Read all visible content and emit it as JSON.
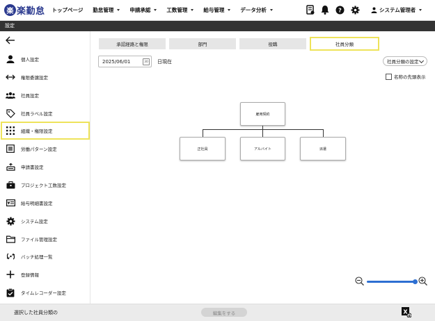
{
  "app": {
    "logo_mark": "楽",
    "logo_text": "楽勤怠"
  },
  "nav": {
    "items": [
      {
        "label": "トップページ",
        "dropdown": false
      },
      {
        "label": "勤怠管理",
        "dropdown": true
      },
      {
        "label": "申請承認",
        "dropdown": true
      },
      {
        "label": "工数管理",
        "dropdown": true
      },
      {
        "label": "給与管理",
        "dropdown": true
      },
      {
        "label": "データ分析",
        "dropdown": true
      }
    ],
    "icons": [
      "report-icon",
      "bell-icon",
      "help-icon",
      "gear-icon"
    ],
    "user_label": "システム管理者"
  },
  "page_bar": {
    "title": "設定"
  },
  "sidebar": {
    "back_icon": "arrow-left-icon",
    "items": [
      {
        "label": "個人設定",
        "icon": "person-icon"
      },
      {
        "label": "権限委譲設定",
        "icon": "swap-arrows-icon"
      },
      {
        "label": "社員設定",
        "icon": "group-icon"
      },
      {
        "label": "社員ラベル設定",
        "icon": "tag-icon"
      },
      {
        "label": "組織・権限設定",
        "icon": "grid-dots-icon",
        "selected": true
      },
      {
        "label": "労働パターン設定",
        "icon": "list-icon"
      },
      {
        "label": "申請書設定",
        "icon": "inbox-icon"
      },
      {
        "label": "プロジェクト工数設定",
        "icon": "briefcase-icon"
      },
      {
        "label": "給与明細書設定",
        "icon": "payslip-icon"
      },
      {
        "label": "システム設定",
        "icon": "gear-icon"
      },
      {
        "label": "ファイル管理設定",
        "icon": "folder-icon"
      },
      {
        "label": "バッチ処理一覧",
        "icon": "sync-icon"
      },
      {
        "label": "登録情報",
        "icon": "plus-icon"
      },
      {
        "label": "タイムレコーダー設定",
        "icon": "clipboard-check-icon"
      }
    ]
  },
  "tabs": [
    {
      "label": "承認経路と権限",
      "active": false
    },
    {
      "label": "部門",
      "active": false
    },
    {
      "label": "役職",
      "active": false
    },
    {
      "label": "社員分類",
      "active": true
    }
  ],
  "date_filter": {
    "value": "2025/06/01",
    "calendar_text": "30",
    "suffix": "日現在"
  },
  "settings_dropdown": {
    "label": "社員分類の設定"
  },
  "checkbox": {
    "label": "名称の先頭表示",
    "checked": false
  },
  "org_chart": {
    "root": "雇用契約",
    "children": [
      "正社員",
      "アルバイト",
      "派遣"
    ]
  },
  "zoom": {
    "level": 1.0
  },
  "footer": {
    "selected_label": "選択した社員分類の",
    "edit_button": "編集をする",
    "export_icon": "excel-export-icon"
  }
}
